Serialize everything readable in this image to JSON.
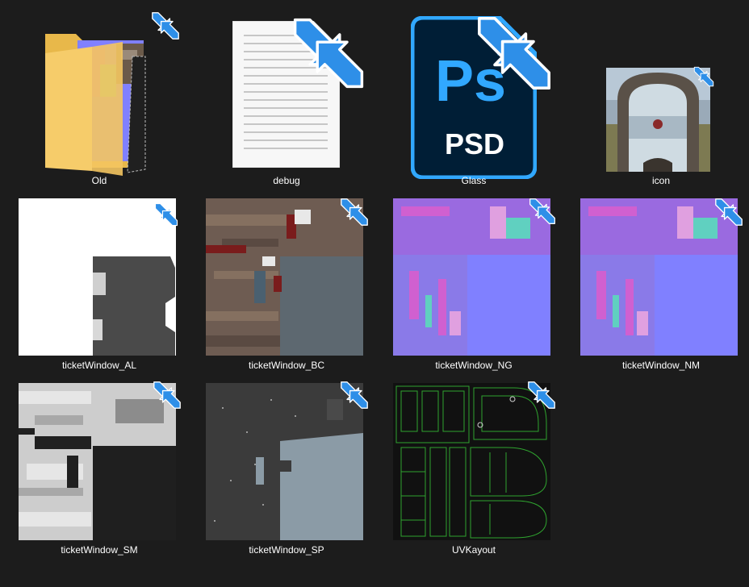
{
  "files": [
    {
      "name": "Old",
      "icon": "folder-icon"
    },
    {
      "name": "debug",
      "icon": "text-document-icon"
    },
    {
      "name": "Glass",
      "icon": "photoshop-psd-icon",
      "badge_text_1": "Ps",
      "badge_text_2": "PSD"
    },
    {
      "name": "icon",
      "icon": "image-thumbnail-icon"
    },
    {
      "name": "ticketWindow_AL",
      "icon": "image-thumbnail-icon"
    },
    {
      "name": "ticketWindow_BC",
      "icon": "image-thumbnail-icon"
    },
    {
      "name": "ticketWindow_NG",
      "icon": "image-thumbnail-icon"
    },
    {
      "name": "ticketWindow_NM",
      "icon": "image-thumbnail-icon"
    },
    {
      "name": "ticketWindow_SM",
      "icon": "image-thumbnail-icon"
    },
    {
      "name": "ticketWindow_SP",
      "icon": "image-thumbnail-icon"
    },
    {
      "name": "UVKayout",
      "icon": "image-thumbnail-icon"
    }
  ],
  "colors": {
    "background": "#1c1c1c",
    "text": "#ffffff",
    "compress_arrow": "#2e8fe8",
    "folder": "#f4c561",
    "psd_dark": "#001e36",
    "psd_blue": "#31a8ff",
    "normal_map": "#8080ff"
  }
}
